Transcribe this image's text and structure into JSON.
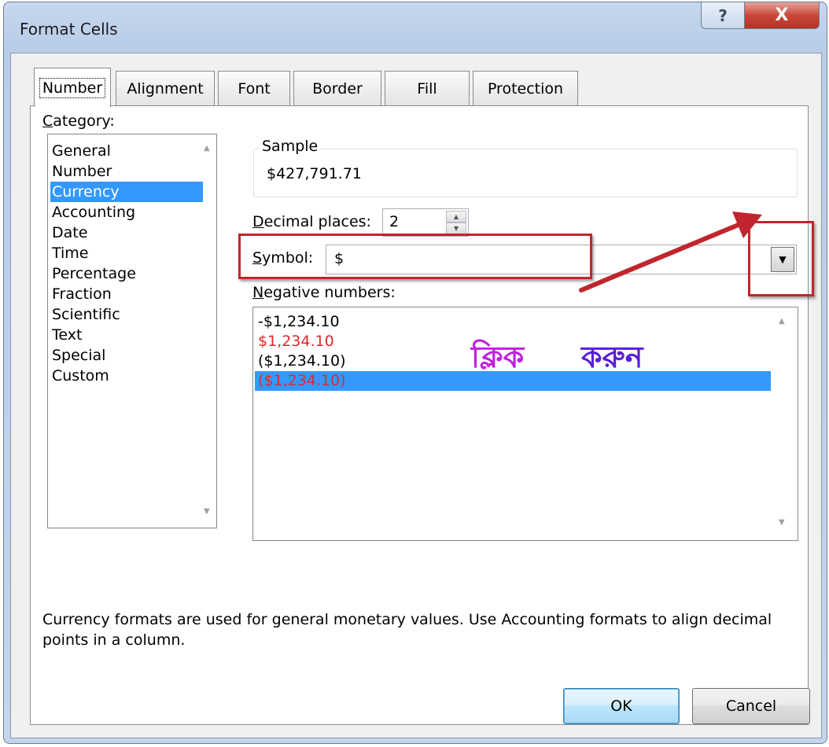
{
  "window": {
    "title": "Format Cells",
    "help_glyph": "?",
    "close_glyph": "X"
  },
  "tabs": [
    {
      "label": "Number",
      "active": true
    },
    {
      "label": "Alignment",
      "active": false
    },
    {
      "label": "Font",
      "active": false
    },
    {
      "label": "Border",
      "active": false
    },
    {
      "label": "Fill",
      "active": false
    },
    {
      "label": "Protection",
      "active": false
    }
  ],
  "category": {
    "label_accel": "C",
    "label_rest": "ategory:",
    "items": [
      "General",
      "Number",
      "Currency",
      "Accounting",
      "Date",
      "Time",
      "Percentage",
      "Fraction",
      "Scientific",
      "Text",
      "Special",
      "Custom"
    ],
    "selected": "Currency"
  },
  "sample": {
    "label": "Sample",
    "value": "$427,791.71"
  },
  "decimal_places": {
    "label_accel": "D",
    "label_rest": "ecimal places:",
    "value": "2"
  },
  "symbol": {
    "label_accel": "S",
    "label_rest": "ymbol:",
    "value": "$"
  },
  "negative_numbers": {
    "label_accel": "N",
    "label_rest": "egative numbers:",
    "items": [
      {
        "text": "-$1,234.10",
        "style": "black"
      },
      {
        "text": "$1,234.10",
        "style": "red"
      },
      {
        "text": "($1,234.10)",
        "style": "black"
      },
      {
        "text": "($1,234.10)",
        "style": "red"
      }
    ],
    "selected_index": 3
  },
  "description": "Currency formats are used for general monetary values.  Use Accounting formats to align decimal points in a column.",
  "annotation": {
    "word1": "ক্লিক",
    "word2": "করুন",
    "color_word1": "#c020e0",
    "color_word2": "#5a1fd6",
    "highlight_color": "#c0262d"
  },
  "buttons": {
    "ok": "OK",
    "cancel": "Cancel"
  },
  "colors": {
    "selection": "#3399ff",
    "negative_red": "#e3262b"
  }
}
